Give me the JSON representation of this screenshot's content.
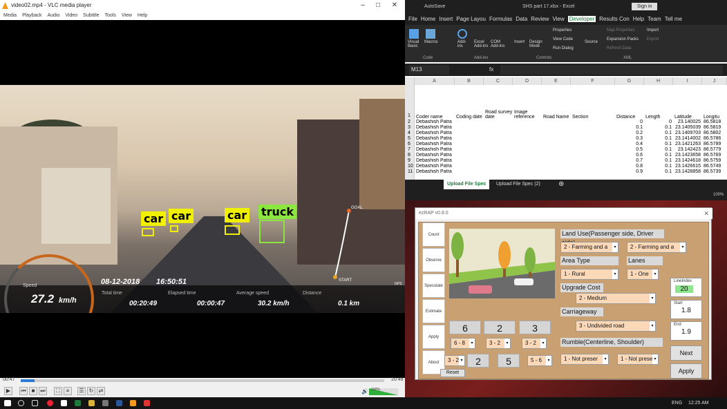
{
  "vlc": {
    "title": "video02.mp4 - VLC media player",
    "menu": [
      "Media",
      "Playback",
      "Audio",
      "Video",
      "Subtitle",
      "Tools",
      "View",
      "Help"
    ],
    "time_current": "00:47",
    "time_total": "20:49",
    "progress": 0.038,
    "volume": "100%"
  },
  "detections": [
    {
      "label": "car"
    },
    {
      "label": "car"
    },
    {
      "label": "car"
    },
    {
      "label": "truck"
    }
  ],
  "hud": {
    "speed_label": "Speed",
    "speed_value": "27.2",
    "speed_unit": "km/h",
    "date": "08-12-2018",
    "time": "16:50:51",
    "total_time_label": "Total time",
    "total_time": "00:20:49",
    "elapsed_label": "Elapsed time",
    "elapsed": "00:00:47",
    "avg_label": "Average speed",
    "avg": "30.2 km/h",
    "dist_label": "Distance",
    "dist": "0.1 km",
    "goal": "GOAL",
    "start": "START",
    "gps": "GPS"
  },
  "excel": {
    "autosave": "AutoSave",
    "title": "SHS part 17.xlsx - Excel",
    "signin": "Sign in",
    "tabs": [
      "File",
      "Home",
      "Insert",
      "Page Layou",
      "Formulas",
      "Data",
      "Review",
      "View",
      "Developer",
      "Results Con",
      "Help",
      "Team",
      "Tell me"
    ],
    "ribbon": {
      "code": "Code",
      "addins": "Add-ins",
      "controls": "Controls",
      "xml": "XML",
      "vb": "Visual Basic",
      "macros": "Macros",
      "addins_btn": "Add-ins",
      "excel_addins": "Excel Add-ins",
      "com_addins": "COM Add-ins",
      "insert": "Insert",
      "design": "Design Mode",
      "properties": "Properties",
      "viewcode": "View Code",
      "rundialog": "Run Dialog",
      "source": "Source",
      "mapprops": "Map Properties",
      "exppacks": "Expansion Packs",
      "refresh": "Refresh Data",
      "import": "Import",
      "export": "Export"
    },
    "namebox": "M13",
    "fx": "fx",
    "cols": [
      "A",
      "B",
      "C",
      "D",
      "E",
      "F",
      "G",
      "H",
      "I",
      "J"
    ],
    "headers": [
      "Coder name",
      "Coding date",
      "Road survey date",
      "Image reference",
      "Road Name",
      "Section",
      "Distance",
      "Length",
      "Latitude",
      "Longitu"
    ],
    "rows": [
      [
        "Debashish Patra",
        "0",
        "0",
        "23.140025",
        "86.5818"
      ],
      [
        "Debashish Patra",
        "0.1",
        "0.1",
        "23.1405039",
        "86.5819"
      ],
      [
        "Debashish Patra",
        "0.2",
        "0.1",
        "23.1409703",
        "86.5802"
      ],
      [
        "Debashish Patra",
        "0.3",
        "0.1",
        "23.1414002",
        "86.5786"
      ],
      [
        "Debashish Patra",
        "0.4",
        "0.1",
        "23.1421263",
        "86.5789"
      ],
      [
        "Debashish Patra",
        "0.5",
        "0.1",
        "23.142423",
        "86.5779"
      ],
      [
        "Debashish Patra",
        "0.6",
        "0.1",
        "23.1423658",
        "86.5769"
      ],
      [
        "Debashish Patra",
        "0.7",
        "0.1",
        "23.1424618",
        "86.5759"
      ],
      [
        "Debashish Patra",
        "0.8",
        "0.1",
        "23.1426615",
        "86.5749"
      ],
      [
        "Debashish Patra",
        "0.9",
        "0.1",
        "23.1428858",
        "86.5739"
      ]
    ],
    "sheet1": "Upload File Spec",
    "sheet2": "Upload File Spec (2)",
    "zoom": "100%"
  },
  "ezrap": {
    "title": "ezRAP v0.8.0",
    "tabs": [
      "Count",
      "Observe",
      "Speculate",
      "Estimate",
      "Apply",
      "About"
    ],
    "land_use_label": "Land Use(Passenger side, Driver side)",
    "land_use_p": "2 - Farming and a",
    "land_use_d": "2 - Farming and a",
    "area_type_label": "Area Type",
    "area_type": "1 - Rural",
    "lanes_label": "Lanes",
    "lanes": "1 - One",
    "upgrade_label": "Upgrade Cost",
    "upgrade": "2 - Medium",
    "carriage_label": "Carriageway",
    "carriage": "3 - Undivided road",
    "rumble_label": "Rumble(Centerline, Shoulder)",
    "rumble_c": "1 - Not preser",
    "rumble_s": "1 - Not prese",
    "counts": [
      "6",
      "2",
      "3"
    ],
    "count_dd": [
      "6 - 8",
      "3 - 2",
      "3 - 2"
    ],
    "left_dd": "3 - 2",
    "mid": [
      "2",
      "5"
    ],
    "right_dd": "5 - 6",
    "lineindex_label": "LineIndex",
    "lineindex": "20",
    "start_label": "Start",
    "start": "1.8",
    "end_label": "End",
    "end": "1.9",
    "next": "Next",
    "apply": "Apply",
    "reset": "Reset"
  },
  "taskbar": {
    "lang": "ENG",
    "time": "12:25 AM"
  }
}
